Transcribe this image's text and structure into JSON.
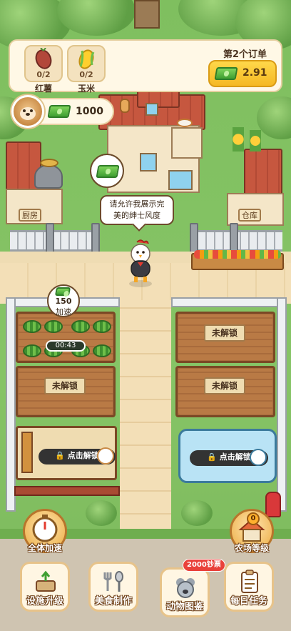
{
  "order": {
    "title": "第2个订单",
    "items": [
      {
        "name": "红薯",
        "progress": "0/2",
        "icon": "sweet-potato-icon"
      },
      {
        "name": "玉米",
        "progress": "0/2",
        "icon": "corn-icon"
      }
    ],
    "reward": "2.91"
  },
  "player": {
    "money": "1000",
    "avatar": "dog-avatar"
  },
  "speech": {
    "line1": "请允许我展示完",
    "line2": "美的绅士风度"
  },
  "buildings": {
    "kitchen_sign": "厨房",
    "warehouse_sign": "仓库"
  },
  "speedup": {
    "amount": "150",
    "label": "加速"
  },
  "timer": "00:43",
  "plots": {
    "locked_label": "未解锁",
    "click_unlock": "点击解锁"
  },
  "side_buttons": {
    "all_speedup": "全体加速",
    "farm_level": "农场等级",
    "farm_level_value": "0"
  },
  "bottom_nav": [
    {
      "label": "设施升级",
      "icon": "facility-upgrade-icon"
    },
    {
      "label": "美食制作",
      "icon": "food-cooking-icon"
    },
    {
      "label": "动物图鉴",
      "icon": "animal-album-icon",
      "badge": "2000钞票"
    },
    {
      "label": "每日任务",
      "icon": "daily-task-icon"
    }
  ],
  "colors": {
    "accent": "#f5b823",
    "cash": "#3f9f32",
    "panel": "#fff8e6",
    "ice_pool": "#b9e3f5"
  }
}
